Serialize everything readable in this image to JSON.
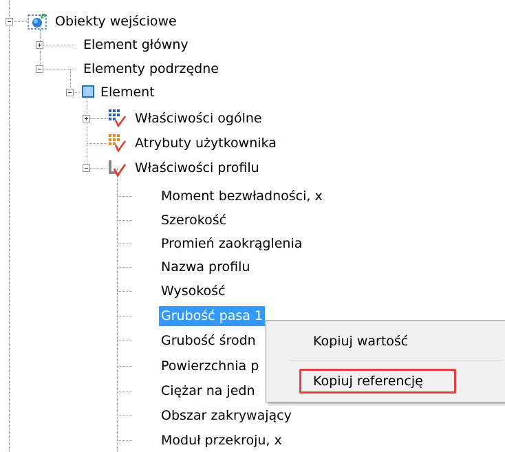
{
  "tree": {
    "root": "Obiekty wejściowe",
    "element_glowny": "Element główny",
    "elementy_podrzedne": "Elementy podrzędne",
    "element": "Element",
    "wlasciwosci_ogolne": "Właściwości ogólne",
    "atrybuty_uzytkownika": "Atrybuty użytkownika",
    "wlasciwosci_profilu": "Właściwości profilu",
    "profile_items": [
      "Moment bezwładności, x",
      "Szerokość",
      "Promień zaokrąglenia",
      "Nazwa profilu",
      "Wysokość",
      "Grubość pasa 1",
      "Grubość środn",
      "Powierzchnia p",
      "Ciężar na jedn",
      "Obszar zakrywający",
      "Moduł przekroju, x"
    ],
    "selected_index": 5
  },
  "context_menu": {
    "items": [
      "Kopiuj wartość",
      "Kopiuj referencję"
    ],
    "highlighted_index": 1,
    "highlight_color": "#e2403c"
  },
  "colors": {
    "selection": "#3399ff"
  }
}
